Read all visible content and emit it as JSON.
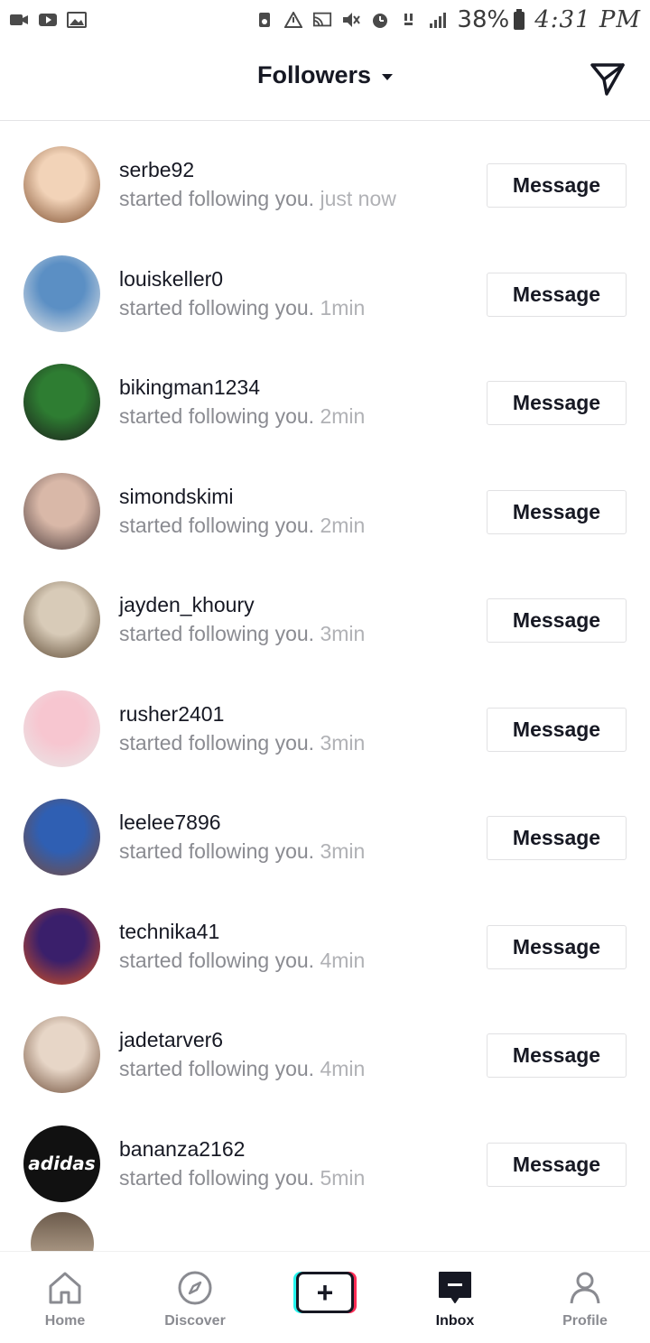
{
  "status_bar": {
    "battery": "38%",
    "time": "4:31 PM",
    "icons": [
      "video-icon",
      "youtube-icon",
      "gallery-icon",
      "bixby-icon",
      "alert-icon",
      "cast-icon",
      "mute-icon",
      "alarm-icon",
      "lte-icon",
      "signal-icon",
      "battery-icon"
    ]
  },
  "header": {
    "title": "Followers",
    "send_icon": "paper-plane-icon"
  },
  "followers": [
    {
      "username": "serbe92",
      "activity": "started following you.",
      "time": "just now",
      "button": "Message",
      "avatar_colors": [
        "#f2d3b8",
        "#7a4a2a"
      ]
    },
    {
      "username": "louiskeller0",
      "activity": "started following you.",
      "time": "1min",
      "button": "Message",
      "avatar_colors": [
        "#5b8fc4",
        "#e8e8e8"
      ]
    },
    {
      "username": "bikingman1234",
      "activity": "started following you.",
      "time": "2min",
      "button": "Message",
      "avatar_colors": [
        "#2e7d32",
        "#1b1b1b"
      ]
    },
    {
      "username": "simondskimi",
      "activity": "started following you.",
      "time": "2min",
      "button": "Message",
      "avatar_colors": [
        "#d9b8a8",
        "#4a3a3a"
      ]
    },
    {
      "username": "jayden_khoury",
      "activity": "started following you.",
      "time": "3min",
      "button": "Message",
      "avatar_colors": [
        "#d8cbb8",
        "#5a4630"
      ]
    },
    {
      "username": "rusher2401",
      "activity": "started following you.",
      "time": "3min",
      "button": "Message",
      "avatar_colors": [
        "#f7c6d0",
        "#e8e8e8"
      ]
    },
    {
      "username": "leelee7896",
      "activity": "started following you.",
      "time": "3min",
      "button": "Message",
      "avatar_colors": [
        "#2f5fb3",
        "#7a4b3a"
      ]
    },
    {
      "username": "technika41",
      "activity": "started following you.",
      "time": "4min",
      "button": "Message",
      "avatar_colors": [
        "#3a1f6b",
        "#d9531e"
      ]
    },
    {
      "username": "jadetarver6",
      "activity": "started following you.",
      "time": "4min",
      "button": "Message",
      "avatar_colors": [
        "#e7d6c7",
        "#6b4a35"
      ]
    },
    {
      "username": "bananza2162",
      "activity": "started following you.",
      "time": "5min",
      "button": "Message",
      "avatar_colors": [
        "#111111",
        "#ffffff"
      ],
      "avatar_text": "adidas"
    }
  ],
  "bottom_nav": [
    {
      "label": "Home",
      "icon": "home-icon",
      "active": false
    },
    {
      "label": "Discover",
      "icon": "compass-icon",
      "active": false
    },
    {
      "label": "",
      "icon": "create-plus-icon",
      "active": false
    },
    {
      "label": "Inbox",
      "icon": "inbox-icon",
      "active": true
    },
    {
      "label": "Profile",
      "icon": "profile-icon",
      "active": false
    }
  ]
}
